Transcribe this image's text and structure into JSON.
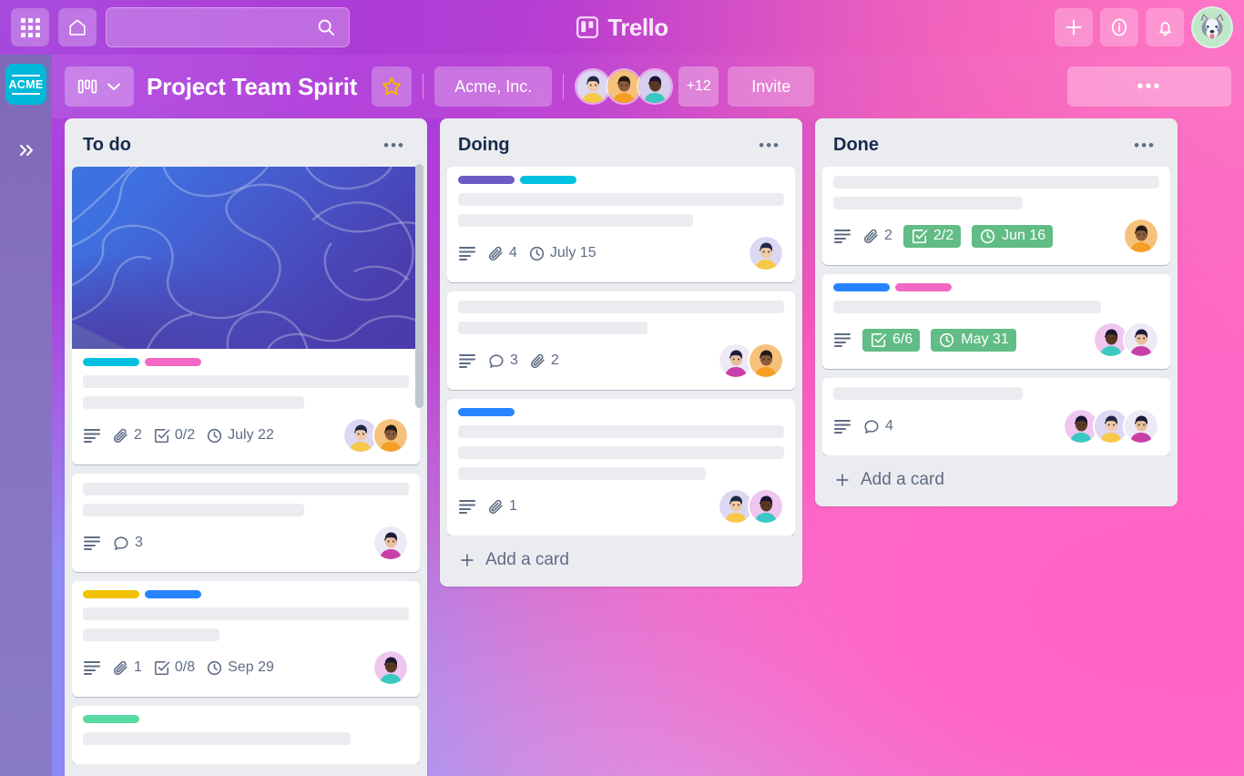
{
  "topbar": {
    "apps_icon": "grid-apps-icon",
    "home_icon": "home-icon",
    "search_placeholder": "",
    "search_value": "",
    "search_icon": "search-icon",
    "brand_name": "Trello",
    "brand_icon": "trello-logo-icon",
    "add_icon": "plus-icon",
    "info_icon": "info-icon",
    "notifications_icon": "bell-icon",
    "profile_icon": "husky-avatar"
  },
  "rail": {
    "workspace_logo_text": "ACME",
    "expand_icon": "chevron-double-right-icon"
  },
  "boardbar": {
    "view_icon": "board-columns-icon",
    "view_chevron": "chevron-down-icon",
    "title": "Project Team Spirit",
    "star_icon": "star-icon",
    "org_name": "Acme, Inc.",
    "member_overflow": "+12",
    "invite_label": "Invite",
    "more_label": "•••",
    "members": [
      {
        "name": "member-avatar-1",
        "skin": "#F0C9A8",
        "hair": "#1F2A44",
        "shirt": "#F7C948",
        "bg": "#DCD7F2"
      },
      {
        "name": "member-avatar-2",
        "skin": "#8A5A3B",
        "hair": "#241A14",
        "shirt": "#F59E26",
        "bg": "#F6C17A"
      },
      {
        "name": "member-avatar-3",
        "skin": "#5A3A22",
        "hair": "#1B1432",
        "shirt": "#39C9C2",
        "bg": "#D7CDEE"
      }
    ]
  },
  "lists": [
    {
      "title": "To do",
      "menu_icon": "list-menu-icon",
      "add_card_label": "",
      "has_scrollbar": true,
      "cards": [
        {
          "name": "card-cover-topographic",
          "cover": true,
          "labels": [
            "#00C2E0",
            "#F368C4"
          ],
          "skeletons": [
            100,
            68
          ],
          "meta": [
            {
              "icon": "description-icon",
              "text": ""
            },
            {
              "icon": "attachment-icon",
              "text": "2"
            },
            {
              "icon": "checklist-icon",
              "text": "0/2"
            },
            {
              "icon": "clock-icon",
              "text": "July 22"
            }
          ],
          "avatars": [
            {
              "name": "card-avatar-a",
              "skin": "#F0C9A8",
              "hair": "#1F2A44",
              "shirt": "#F7C948",
              "bg": "#DCD7F2"
            },
            {
              "name": "card-avatar-b",
              "skin": "#8A5A3B",
              "hair": "#241A14",
              "shirt": "#F59E26",
              "bg": "#F6C17A"
            }
          ]
        },
        {
          "name": "card-plain-comments",
          "cover": false,
          "labels": [],
          "skeletons": [
            100,
            68
          ],
          "meta": [
            {
              "icon": "description-icon",
              "text": ""
            },
            {
              "icon": "comment-icon",
              "text": "3"
            }
          ],
          "avatars": [
            {
              "name": "card-avatar-c",
              "skin": "#E8BE9E",
              "hair": "#1B1B3A",
              "shirt": "#C93FA8",
              "bg": "#EDE9F5"
            }
          ]
        },
        {
          "name": "card-yellow-blue-labels",
          "cover": false,
          "labels": [
            "#F2C200",
            "#2684FF"
          ],
          "skeletons": [
            100,
            42
          ],
          "meta": [
            {
              "icon": "description-icon",
              "text": ""
            },
            {
              "icon": "attachment-icon",
              "text": "1"
            },
            {
              "icon": "checklist-icon",
              "text": "0/8"
            },
            {
              "icon": "clock-icon",
              "text": "Sep 29"
            }
          ],
          "avatars": [
            {
              "name": "card-avatar-d",
              "skin": "#5A3A22",
              "hair": "#1B1432",
              "shirt": "#39C9C2",
              "bg": "#EFC6F0"
            }
          ]
        },
        {
          "name": "card-green-label-partial",
          "cover": false,
          "labels": [
            "#57D9A3"
          ],
          "skeletons": [
            82
          ],
          "meta": [],
          "avatars": []
        }
      ]
    },
    {
      "title": "Doing",
      "menu_icon": "list-menu-icon",
      "add_card_label": "Add a card",
      "has_scrollbar": false,
      "cards": [
        {
          "name": "card-purple-cyan-labels",
          "cover": false,
          "labels": [
            "#6B5CC4",
            "#00C2E0"
          ],
          "skeletons": [
            100,
            72
          ],
          "meta": [
            {
              "icon": "description-icon",
              "text": ""
            },
            {
              "icon": "attachment-icon",
              "text": "4"
            },
            {
              "icon": "clock-icon",
              "text": "July 15"
            }
          ],
          "avatars": [
            {
              "name": "card-avatar-e",
              "skin": "#F0C9A8",
              "hair": "#1F2A44",
              "shirt": "#F7C948",
              "bg": "#DCD7F2"
            }
          ]
        },
        {
          "name": "card-comments-attachments",
          "cover": false,
          "labels": [],
          "skeletons": [
            100,
            58
          ],
          "meta": [
            {
              "icon": "description-icon",
              "text": ""
            },
            {
              "icon": "comment-icon",
              "text": "3"
            },
            {
              "icon": "attachment-icon",
              "text": "2"
            }
          ],
          "avatars": [
            {
              "name": "card-avatar-f",
              "skin": "#E8BE9E",
              "hair": "#1B1B3A",
              "shirt": "#C93FA8",
              "bg": "#EDE9F5"
            },
            {
              "name": "card-avatar-g",
              "skin": "#8A5A3B",
              "hair": "#241A14",
              "shirt": "#F59E26",
              "bg": "#F6C17A"
            }
          ]
        },
        {
          "name": "card-blue-label-three-lines",
          "cover": false,
          "labels": [
            "#2684FF"
          ],
          "skeletons": [
            100,
            100,
            76
          ],
          "meta": [
            {
              "icon": "description-icon",
              "text": ""
            },
            {
              "icon": "attachment-icon",
              "text": "1"
            }
          ],
          "avatars": [
            {
              "name": "card-avatar-h",
              "skin": "#F0C9A8",
              "hair": "#1F2A44",
              "shirt": "#F7C948",
              "bg": "#DCD7F2"
            },
            {
              "name": "card-avatar-i",
              "skin": "#5A3A22",
              "hair": "#1B1432",
              "shirt": "#39C9C2",
              "bg": "#EFC6F0"
            }
          ]
        }
      ]
    },
    {
      "title": "Done",
      "menu_icon": "list-menu-icon",
      "add_card_label": "Add a card",
      "has_scrollbar": false,
      "cards": [
        {
          "name": "card-done-jun16",
          "cover": false,
          "labels": [],
          "skeletons": [
            100,
            58
          ],
          "meta": [
            {
              "icon": "description-icon",
              "text": ""
            },
            {
              "icon": "attachment-icon",
              "text": "2"
            },
            {
              "icon": "checklist-icon",
              "text": "2/2",
              "style": "green"
            },
            {
              "icon": "clock-icon",
              "text": "Jun 16",
              "style": "green"
            }
          ],
          "avatars": [
            {
              "name": "card-avatar-j",
              "skin": "#8A5A3B",
              "hair": "#241A14",
              "shirt": "#F59E26",
              "bg": "#F6C17A"
            }
          ]
        },
        {
          "name": "card-done-may31",
          "cover": false,
          "labels": [
            "#2684FF",
            "#F368C4"
          ],
          "skeletons": [
            82
          ],
          "meta": [
            {
              "icon": "description-icon",
              "text": ""
            },
            {
              "icon": "checklist-icon",
              "text": "6/6",
              "style": "green"
            },
            {
              "icon": "clock-icon",
              "text": "May 31",
              "style": "green"
            }
          ],
          "avatars": [
            {
              "name": "card-avatar-k",
              "skin": "#5A3A22",
              "hair": "#1B1432",
              "shirt": "#39C9C2",
              "bg": "#EFC6F0"
            },
            {
              "name": "card-avatar-l",
              "skin": "#E8BE9E",
              "hair": "#1B1B3A",
              "shirt": "#C93FA8",
              "bg": "#EDE9F5"
            }
          ]
        },
        {
          "name": "card-done-comments",
          "cover": false,
          "labels": [],
          "skeletons": [
            58
          ],
          "meta": [
            {
              "icon": "description-icon",
              "text": ""
            },
            {
              "icon": "comment-icon",
              "text": "4"
            }
          ],
          "avatars": [
            {
              "name": "card-avatar-m",
              "skin": "#5A3A22",
              "hair": "#1B1432",
              "shirt": "#39C9C2",
              "bg": "#EFC6F0"
            },
            {
              "name": "card-avatar-n",
              "skin": "#F0C9A8",
              "hair": "#1F2A44",
              "shirt": "#F7C948",
              "bg": "#DCD7F2"
            },
            {
              "name": "card-avatar-o",
              "skin": "#E8BE9E",
              "hair": "#1B1B3A",
              "shirt": "#C93FA8",
              "bg": "#EDE9F5"
            }
          ]
        }
      ]
    }
  ],
  "colors": {
    "list_bg": "#EBECF0",
    "card_bg": "#FFFFFF",
    "text_dark": "#172B4D",
    "text_muted": "#5E6C84",
    "green_badge": "#61BD85",
    "acme_teal": "#00B8D9",
    "star_gold": "#F2B705"
  }
}
